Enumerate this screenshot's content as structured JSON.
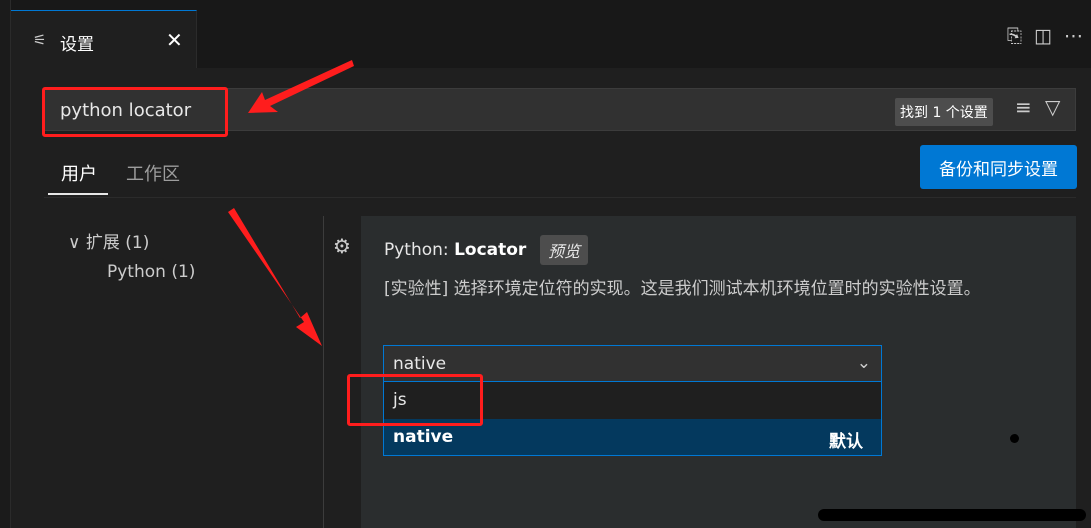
{
  "editor": {
    "tab": {
      "label": "设置",
      "icon": "settings-sliders-icon",
      "close_icon": "close-icon"
    },
    "actions": [
      "open-settings-json-icon",
      "split-editor-icon",
      "more-actions-icon"
    ]
  },
  "search": {
    "value": "python locator",
    "result_badge": "找到 1 个设置",
    "clear_icon": "clear-filter-icon",
    "filter_icon": "filter-icon"
  },
  "scopes": {
    "user": "用户",
    "workspace": "工作区",
    "active": "用户"
  },
  "sync_button": "备份和同步设置",
  "toc": {
    "extensions": "扩展 (1)",
    "python": "Python (1)"
  },
  "setting": {
    "title_prefix": "Python: ",
    "title_name": "Locator",
    "preview_badge": "预览",
    "description": "[实验性] 选择环境定位符的实现。这是我们测试本机环境位置时的实验性设置。",
    "selected_value": "native",
    "options": [
      {
        "label": "js",
        "default_label": ""
      },
      {
        "label": "native",
        "default_label": "默认"
      }
    ]
  },
  "colors": {
    "accent": "#0078d4",
    "annotation": "#ff1d1d",
    "selection": "#04395e"
  },
  "glyphs": {
    "sliders": "⚟",
    "close": "✕",
    "open_json": "⎘",
    "split": "◫",
    "more": "⋯",
    "clear": "≡",
    "filter": "▽",
    "chevron_toc": "∨",
    "gear": "⚙",
    "chevron_select": "⌄"
  }
}
